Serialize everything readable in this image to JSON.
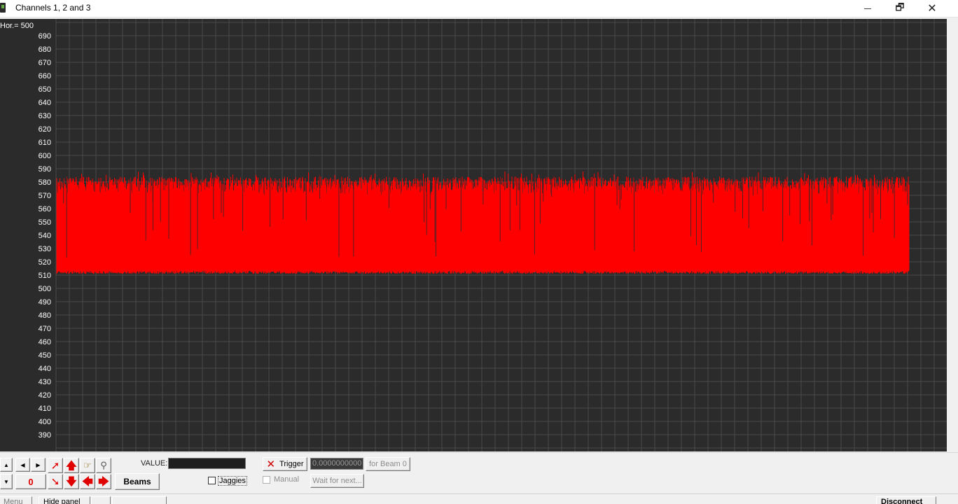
{
  "window": {
    "title": "Channels 1, 2 and 3",
    "minimize_icon": "minimize-icon",
    "maximize_glyph": "🗗",
    "close_glyph": "✕"
  },
  "plot": {
    "horizontal_label": "Hor.= 500",
    "background_color": "#2b2b2b",
    "grid_color": "#4a4a4a",
    "trace_color": "#ff0000",
    "y_ticks": [
      690,
      680,
      670,
      660,
      650,
      640,
      630,
      620,
      610,
      600,
      590,
      580,
      570,
      560,
      550,
      540,
      530,
      520,
      510,
      500,
      490,
      480,
      470,
      460,
      450,
      440,
      430,
      420,
      410,
      400,
      390
    ]
  },
  "chart_data": {
    "type": "line",
    "title": "",
    "xlabel": "",
    "ylabel": "",
    "ylim": [
      380,
      696
    ],
    "grid": true,
    "series": [
      {
        "baseline_min": 511,
        "peak_max": 588,
        "typical_peak": 578
      }
    ]
  },
  "panel": {
    "counter_value": "0",
    "beams_label": "Beams",
    "value_label": "VALUE:",
    "jaggies_label": "Jaggies",
    "jaggies_checked": false,
    "trigger_label": "Trigger",
    "trigger_time": "0.0000000000",
    "for_beam_label": "for Beam 0",
    "manual_label": "Manual",
    "manual_checked": false,
    "wait_label": "Wait for next...",
    "arrow_color": "#e00000"
  },
  "bottom_strip": {
    "menu_label": "Menu",
    "hide_panel_label": "Hide panel",
    "disconnect_label": "Disconnect"
  }
}
